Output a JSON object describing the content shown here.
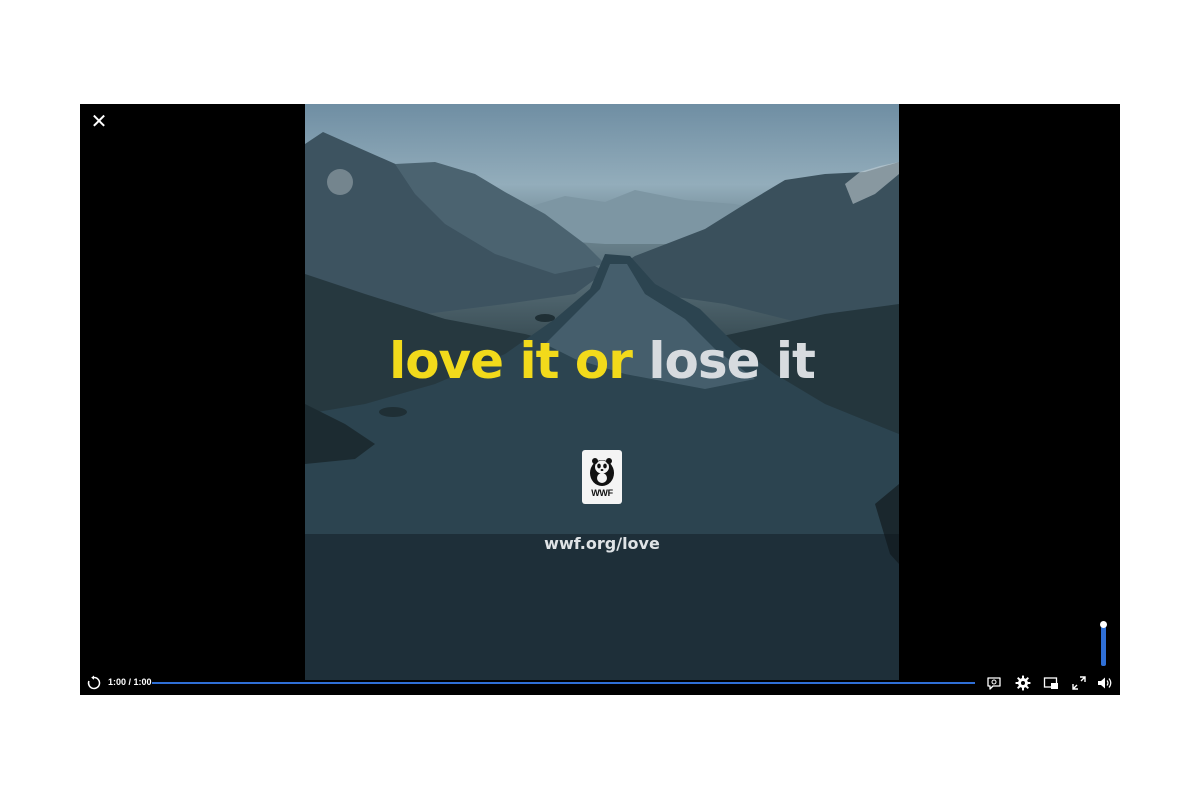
{
  "player": {
    "close_label": "✕",
    "tagline": {
      "part1": "love it or ",
      "part2": "lose it"
    },
    "brand": {
      "logo_text": "WWF",
      "url": "wwf.org/love"
    },
    "controls": {
      "time_display": "1:00 / 1:00",
      "progress_fraction": 1.0,
      "volume_fraction": 1.0
    }
  },
  "colors": {
    "tagline_yellow": "#f2da1b",
    "tagline_grey": "#d7dbdf",
    "accent_blue": "#2f6fd6"
  },
  "icons": [
    "close-icon",
    "replay-icon",
    "captions-icon",
    "settings-icon",
    "picture-in-picture-icon",
    "fullscreen-icon",
    "volume-icon"
  ]
}
